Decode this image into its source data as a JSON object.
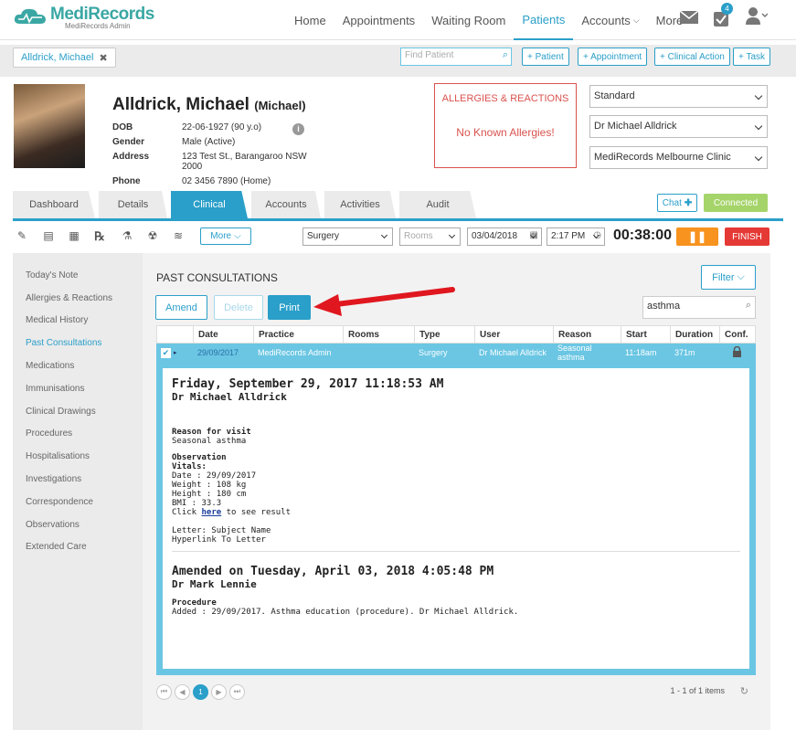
{
  "app": {
    "logo": "MediRecords",
    "logo_sub": "MediRecords Admin"
  },
  "nav": {
    "items": [
      "Home",
      "Appointments",
      "Waiting Room",
      "Patients",
      "Accounts",
      "More"
    ],
    "active": "Patients",
    "task_badge": "4"
  },
  "subbar": {
    "patient_tab": "Alldrick, Michael",
    "find_placeholder": "Find Patient",
    "buttons": [
      "+ Patient",
      "+ Appointment",
      "+ Clinical Action",
      "+ Task"
    ]
  },
  "patient": {
    "name": "Alldrick, Michael",
    "nickname": "(Michael)",
    "fields": [
      {
        "k": "DOB",
        "v": "22-06-1927 (90 y.o)"
      },
      {
        "k": "Gender",
        "v": "Male (Active)"
      },
      {
        "k": "Address",
        "v": "123 Test St., Barangaroo NSW 2000"
      },
      {
        "k": "Phone",
        "v": "02 3456 7890 (Home)"
      }
    ]
  },
  "allergies": {
    "title": "ALLERGIES & REACTIONS",
    "body": "No Known Allergies!"
  },
  "selects": {
    "billing": "Standard",
    "doctor": "Dr Michael Alldrick",
    "clinic": "MediRecords Melbourne Clinic"
  },
  "tabs": [
    "Dashboard",
    "Details",
    "Clinical",
    "Accounts",
    "Activities",
    "Audit"
  ],
  "active_tab": "Clinical",
  "chat_label": "Chat",
  "connected_label": "Connected",
  "toolbar": {
    "more_label": "More",
    "location": "Surgery",
    "rooms_placeholder": "Rooms",
    "date": "03/04/2018",
    "time": "2:17 PM",
    "timer": "00:38:00",
    "pause": "❚❚",
    "finish": "FINISH"
  },
  "sidebar": {
    "items": [
      "Today's Note",
      "Allergies & Reactions",
      "Medical History",
      "Past Consultations",
      "Medications",
      "Immunisations",
      "Clinical Drawings",
      "Procedures",
      "Hospitalisations",
      "Investigations",
      "Correspondence",
      "Observations",
      "Extended Care"
    ],
    "active": "Past Consultations"
  },
  "consult": {
    "title": "PAST CONSULTATIONS",
    "filter": "Filter",
    "amend": "Amend",
    "delete": "Delete",
    "print": "Print",
    "search_value": "asthma",
    "columns": [
      "Date",
      "Practice",
      "Rooms",
      "Type",
      "User",
      "Reason",
      "Start",
      "Duration",
      "Conf."
    ],
    "row": {
      "date": "29/09/2017",
      "practice": "MediRecords Admin",
      "rooms": "",
      "type": "Surgery",
      "user": "Dr Michael Alldrick",
      "reason": "Seasonal asthma",
      "start": "11:18am",
      "duration": "371m"
    },
    "detail": {
      "heading": "Friday, September 29, 2017 11:18:53 AM",
      "doctor": "Dr Michael Alldrick",
      "reason_label": "Reason for visit",
      "reason": "Seasonal asthma",
      "obs_label": "Observation",
      "vitals_label": "Vitals:",
      "vitals": [
        "Date : 29/09/2017",
        "Weight : 108 kg",
        "Height : 180 cm",
        "BMI : 33.3"
      ],
      "click_pre": "Click ",
      "click_link": "here",
      "click_post": " to see result",
      "letter1": "Letter: Subject Name",
      "letter2": "Hyperlink To Letter",
      "amended_heading": "Amended on Tuesday, April 03, 2018 4:05:48 PM",
      "amended_doctor": "Dr Mark Lennie",
      "procedure_label": "Procedure",
      "procedure": "Added : 29/09/2017. Asthma education (procedure). Dr Michael Alldrick."
    },
    "pager": {
      "current": "1",
      "summary": "1 - 1 of 1 items"
    }
  },
  "colors": {
    "accent": "#2a9fc9",
    "row": "#6ac6e3",
    "finish": "#e53935",
    "pause": "#f7931e",
    "connected": "#a5d46a",
    "allergy": "#d9534f",
    "arrow": "#e0171f"
  }
}
